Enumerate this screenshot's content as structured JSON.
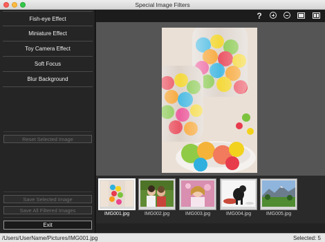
{
  "window": {
    "title": "Special Image Filters"
  },
  "effects": [
    {
      "label": "Fish-eye Effect"
    },
    {
      "label": "Miniature Effect"
    },
    {
      "label": "Toy Camera Effect"
    },
    {
      "label": "Soft Focus"
    },
    {
      "label": "Blur Background"
    }
  ],
  "buttons": {
    "reset": "Reset Selected Image",
    "save_selected": "Save Selected Image",
    "save_all": "Save All Filtered Images",
    "exit": "Exit"
  },
  "toolbar": {
    "help": "?",
    "icons": [
      "help-icon",
      "zoom-in-icon",
      "zoom-out-icon",
      "single-view-icon",
      "compare-view-icon"
    ]
  },
  "thumbnails": [
    {
      "name": "IMG001.jpg",
      "selected": true
    },
    {
      "name": "IMG002.jpg",
      "selected": false
    },
    {
      "name": "IMG003.jpg",
      "selected": false
    },
    {
      "name": "IMG004.jpg",
      "selected": false
    },
    {
      "name": "IMG005.jpg",
      "selected": false
    }
  ],
  "status": {
    "path": "/Users/UserName/Pictures/IMG001.jpg",
    "selected": "Selected: 5"
  },
  "colors": {
    "panel": "#252525",
    "preview_bg": "#555555",
    "statusbar": "#e6e6e6"
  }
}
